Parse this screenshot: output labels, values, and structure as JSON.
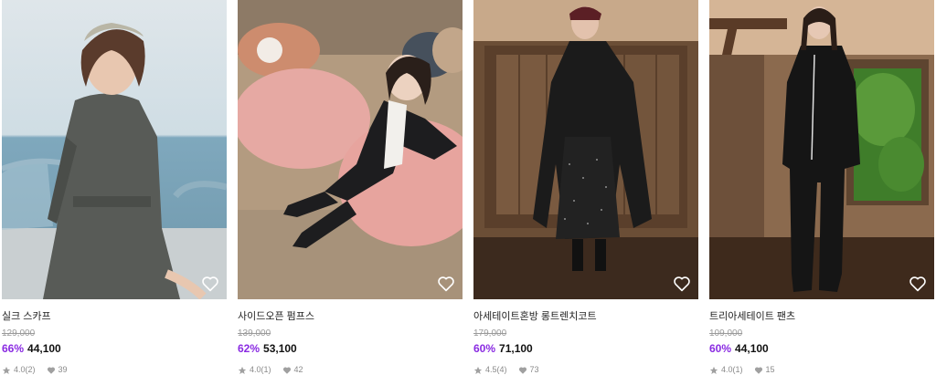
{
  "products": [
    {
      "name": "실크 스카프",
      "original_price": "129,000",
      "discount": "66%",
      "sale_price": "44,100",
      "rating": "4.0(2)",
      "likes": "39",
      "image": "model-in-gray-dress-with-headscarf-by-sea"
    },
    {
      "name": "사이드오픈 펌프스",
      "original_price": "139,000",
      "discount": "62%",
      "sale_price": "53,100",
      "rating": "4.0(1)",
      "likes": "42",
      "image": "model-seated-on-pink-beanbag"
    },
    {
      "name": "아세테이트혼방 롱트렌치코트",
      "original_price": "179,000",
      "discount": "60%",
      "sale_price": "71,100",
      "rating": "4.5(4)",
      "likes": "73",
      "image": "model-in-black-trench-coat-against-wooden-door"
    },
    {
      "name": "트리아세테이트 팬츠",
      "original_price": "109,000",
      "discount": "60%",
      "sale_price": "44,100",
      "rating": "4.0(1)",
      "likes": "15",
      "image": "model-in-black-suit-by-window"
    }
  ],
  "colors": {
    "discount": "#8a2be2",
    "price": "#111111",
    "muted": "#9a9a9a"
  },
  "icons": {
    "wishlist": "heart-outline-icon",
    "rating": "star-icon",
    "likes": "heart-icon"
  }
}
